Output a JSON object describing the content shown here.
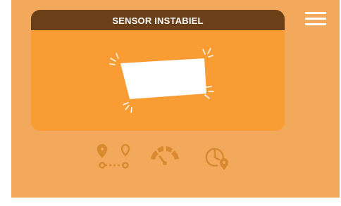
{
  "status_card": {
    "title": "SENSOR INSTABIEL",
    "illustration": "unstable-sensor-icon"
  },
  "toolbar": {
    "menu_icon": "hamburger-menu-icon",
    "items": [
      {
        "icon": "route-distance-icon"
      },
      {
        "icon": "speedometer-gauge-icon"
      },
      {
        "icon": "time-location-icon"
      }
    ]
  },
  "colors": {
    "background": "#f3a95c",
    "card": "#f89c33",
    "card_header": "#6b3f17",
    "icon_muted": "#d98a2f",
    "text_light": "#ffffff"
  }
}
